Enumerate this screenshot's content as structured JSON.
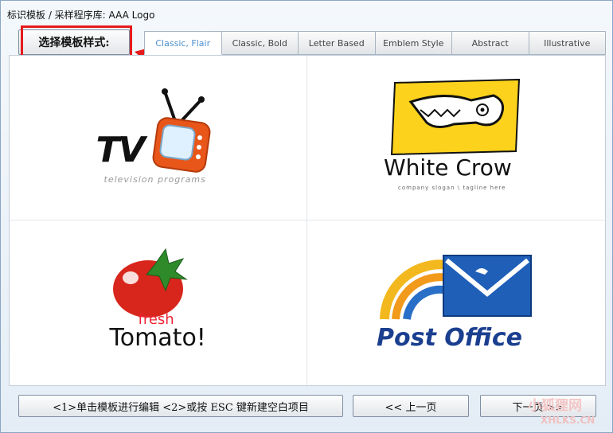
{
  "window": {
    "title": "标识模板 / 采样程序库: AAA Logo"
  },
  "style_button": {
    "label": "选择模板样式:"
  },
  "tabs": [
    {
      "label": "Classic, Flair",
      "active": true
    },
    {
      "label": "Classic, Bold",
      "active": false
    },
    {
      "label": "Letter Based",
      "active": false
    },
    {
      "label": "Emblem Style",
      "active": false
    },
    {
      "label": "Abstract",
      "active": false
    },
    {
      "label": "Illustrative",
      "active": false
    }
  ],
  "logos": {
    "tv": {
      "word": "TV",
      "sub": "television programs"
    },
    "crow": {
      "title": "White Crow",
      "sub": "company slogan \\ tagline here"
    },
    "tomato": {
      "fresh": "fresh",
      "word": "Tomato!"
    },
    "postoffice": {
      "word": "Post Office"
    }
  },
  "bottom": {
    "hint": "<1>单击模板进行编辑  <2>或按 ESC 键新建空白项目",
    "prev": "<< 上一页",
    "next": "下一页 >>"
  },
  "watermark": {
    "top": "小狐狸网",
    "bottom": "XHLKS.CN"
  },
  "colors": {
    "highlight": "#e51b1b",
    "active_tab_text": "#4a8fd0"
  }
}
